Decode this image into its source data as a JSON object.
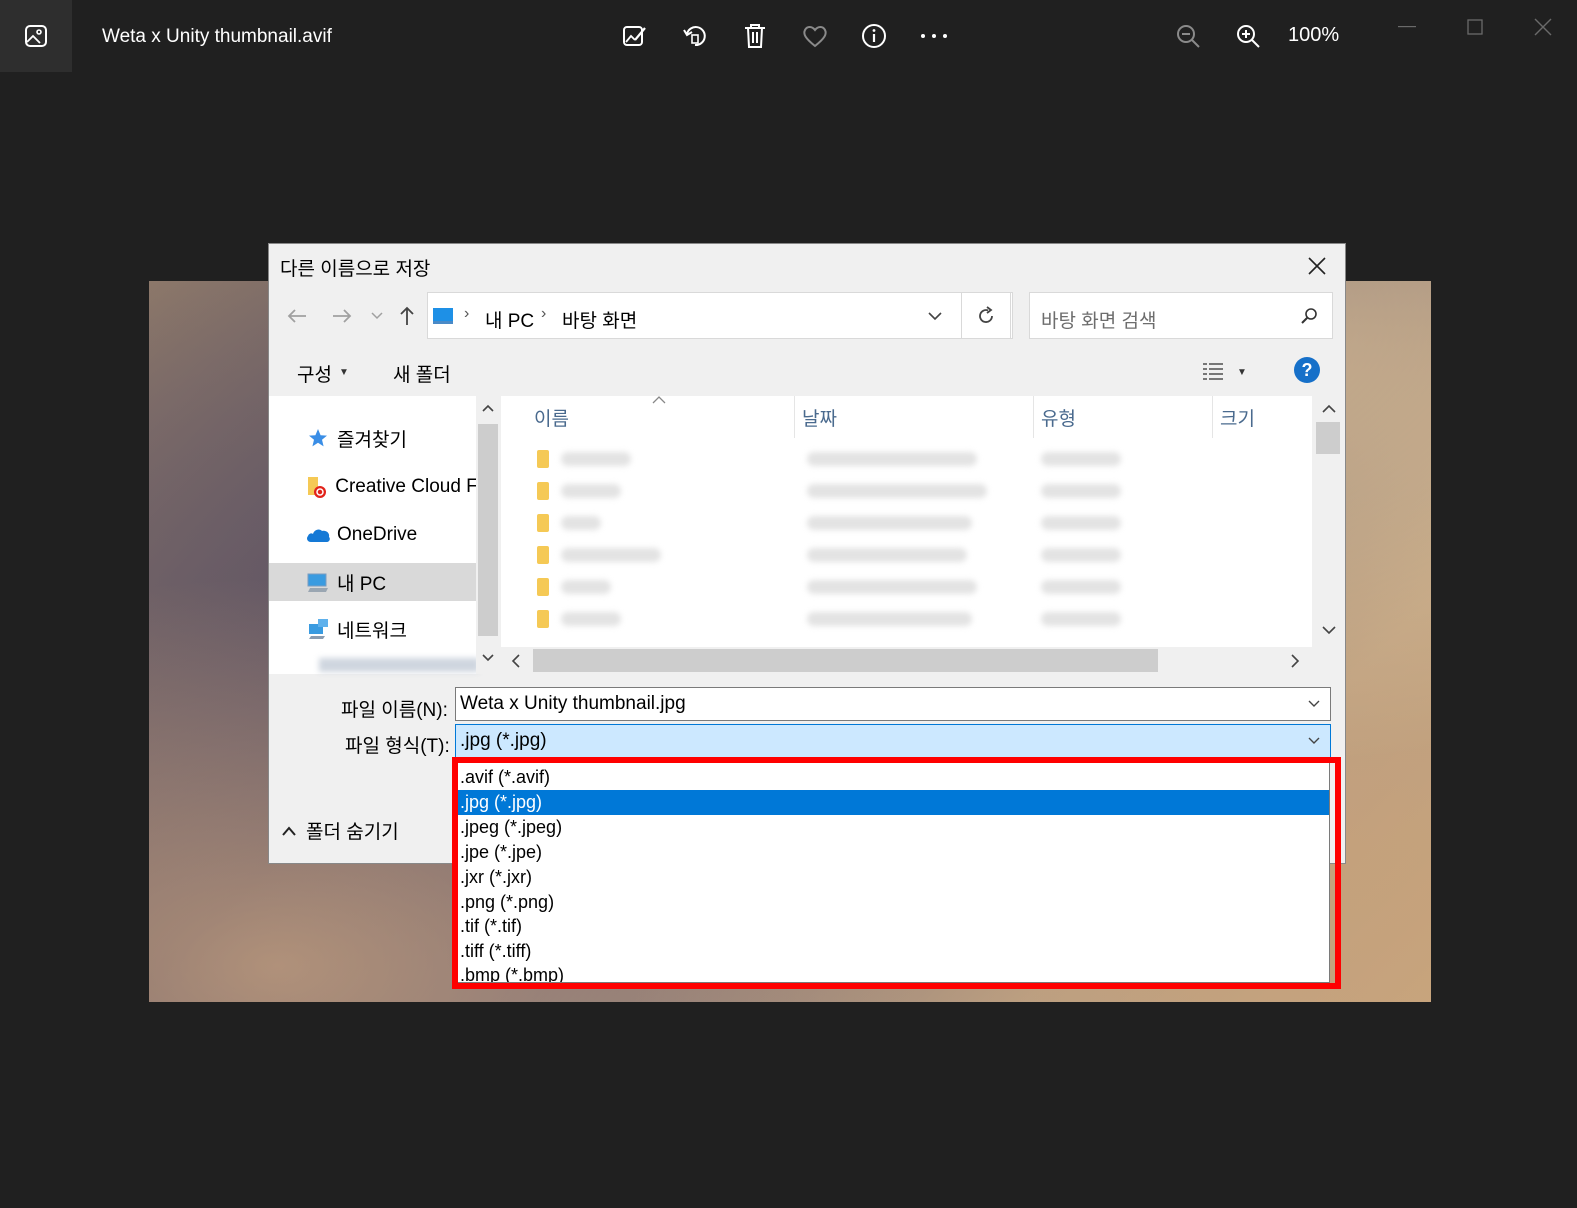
{
  "app": {
    "title": "Weta x Unity thumbnail.avif",
    "zoom": "100%"
  },
  "dialog": {
    "title": "다른 이름으로 저장",
    "breadcrumb": [
      "내 PC",
      "바탕 화면"
    ],
    "search_placeholder": "바탕 화면 검색",
    "toolbar": {
      "organize": "구성",
      "new_folder": "새 폴더"
    },
    "nav_items": [
      {
        "label": "즐겨찾기",
        "icon": "star-icon"
      },
      {
        "label": "Creative Cloud Fil",
        "icon": "creative-cloud-folder-icon"
      },
      {
        "label": "OneDrive",
        "icon": "onedrive-cloud-icon"
      },
      {
        "label": "내 PC",
        "icon": "computer-icon"
      },
      {
        "label": "네트워크",
        "icon": "network-icon"
      }
    ],
    "columns": [
      "이름",
      "날짜",
      "유형",
      "크기"
    ],
    "filename_label": "파일 이름(N):",
    "filename_value": "Weta x Unity thumbnail.jpg",
    "filetype_label": "파일 형식(T):",
    "filetype_value": ".jpg (*.jpg)",
    "hide_folders": "폴더 숨기기",
    "filetype_options": [
      ".avif (*.avif)",
      ".jpg (*.jpg)",
      ".jpeg (*.jpeg)",
      ".jpe (*.jpe)",
      ".jxr (*.jxr)",
      ".png (*.png)",
      ".tif (*.tif)",
      ".tiff (*.tiff)",
      ".bmp (*.bmp)"
    ],
    "selected_option": 1
  },
  "colors": {
    "accent": "#0078d7",
    "highlight": "#ff0000"
  }
}
